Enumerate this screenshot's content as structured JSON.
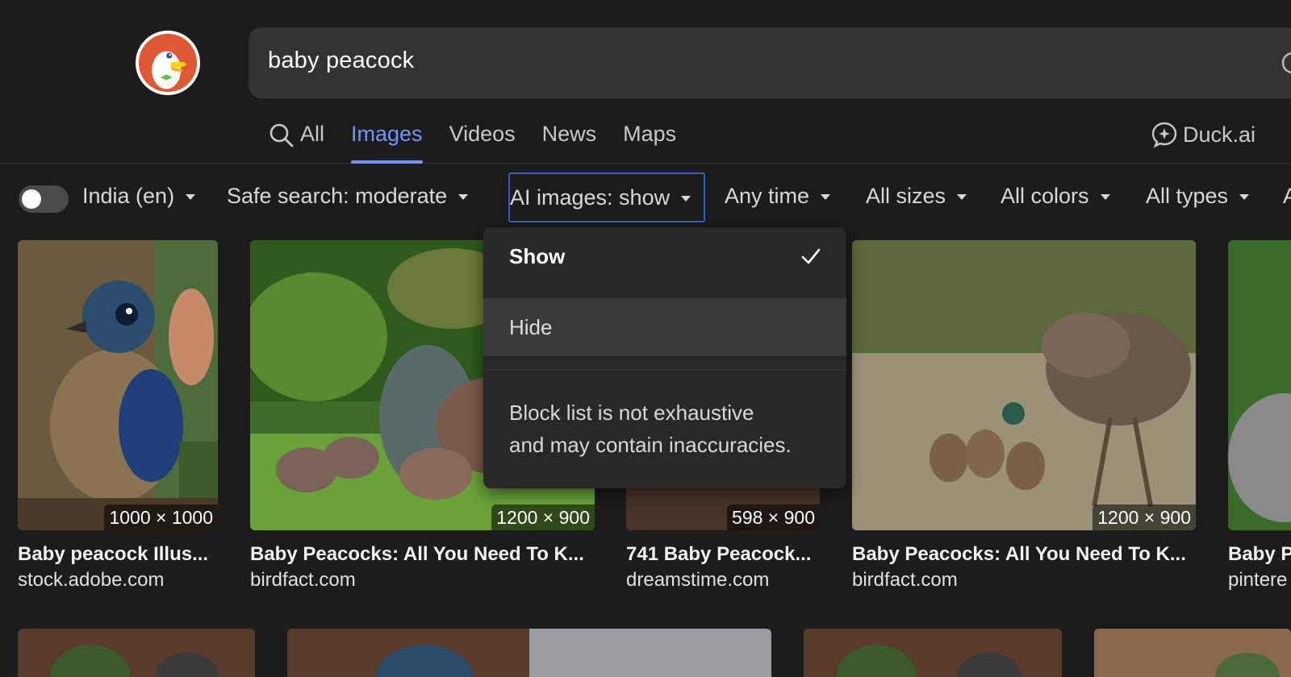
{
  "search": {
    "query": "baby peacock"
  },
  "tabs": [
    {
      "label": "All",
      "icon": "search-icon"
    },
    {
      "label": "Images"
    },
    {
      "label": "Videos"
    },
    {
      "label": "News"
    },
    {
      "label": "Maps"
    }
  ],
  "active_tab": "Images",
  "duck_ai": {
    "label": "Duck.ai",
    "icon": "duck-ai-icon"
  },
  "filters": {
    "region": "India (en)",
    "safe_search": "Safe search: moderate",
    "ai_images": "AI images: show",
    "time": "Any time",
    "size": "All sizes",
    "color": "All colors",
    "type": "All types",
    "more": "A"
  },
  "dropdown": {
    "show_label": "Show",
    "hide_label": "Hide",
    "selected": "Show",
    "note_line1": "Block list is not exhaustive",
    "note_line2": "and may contain inaccuracies."
  },
  "results": [
    {
      "title": "Baby peacock Illus...",
      "site": "stock.adobe.com",
      "dims": "1000 × 1000"
    },
    {
      "title": "Baby Peacocks: All You Need To K...",
      "site": "birdfact.com",
      "dims": "1200 × 900"
    },
    {
      "title": "741 Baby Peacock...",
      "site": "dreamstime.com",
      "dims": "598 × 900"
    },
    {
      "title": "Baby Peacocks: All You Need To K...",
      "site": "birdfact.com",
      "dims": "1200 × 900"
    },
    {
      "title": "Baby P",
      "site": "pintere",
      "dims": ""
    }
  ],
  "colors": {
    "background": "#1c1c1c",
    "search_box": "#333333",
    "accent": "#7295f6",
    "logo": "#de5833",
    "focus_border": "#3b5bcc"
  }
}
